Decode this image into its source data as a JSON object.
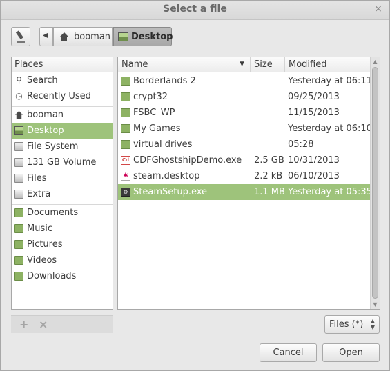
{
  "window": {
    "title": "Select a file",
    "close_glyph": "×"
  },
  "toolbar": {
    "edit_icon": "pencil-icon",
    "back_glyph": "◀",
    "crumbs": [
      {
        "label": "booman",
        "icon": "home-icon"
      },
      {
        "label": "Desktop",
        "icon": "desktop-icon",
        "active": true
      }
    ]
  },
  "places": {
    "header": "Places",
    "items": [
      {
        "label": "Search",
        "icon": "search-icon"
      },
      {
        "label": "Recently Used",
        "icon": "clock-icon"
      },
      {
        "label": "booman",
        "icon": "home-icon"
      },
      {
        "label": "Desktop",
        "icon": "desktop-icon",
        "selected": true
      },
      {
        "label": "File System",
        "icon": "drive-icon"
      },
      {
        "label": "131 GB Volume",
        "icon": "drive-icon"
      },
      {
        "label": "Files",
        "icon": "drive-icon"
      },
      {
        "label": "Extra",
        "icon": "drive-icon"
      },
      {
        "label": "Documents",
        "icon": "folder-documents-icon"
      },
      {
        "label": "Music",
        "icon": "folder-music-icon"
      },
      {
        "label": "Pictures",
        "icon": "folder-pictures-icon"
      },
      {
        "label": "Videos",
        "icon": "folder-videos-icon"
      },
      {
        "label": "Downloads",
        "icon": "folder-downloads-icon"
      }
    ],
    "add_glyph": "+",
    "remove_glyph": "×"
  },
  "files": {
    "columns": {
      "name": "Name",
      "size": "Size",
      "modified": "Modified"
    },
    "sort_glyph": "▼",
    "rows": [
      {
        "name": "Borderlands 2",
        "size": "",
        "modified": "Yesterday at 06:11",
        "icon": "folder-icon"
      },
      {
        "name": "crypt32",
        "size": "",
        "modified": "09/25/2013",
        "icon": "folder-icon"
      },
      {
        "name": "FSBC_WP",
        "size": "",
        "modified": "11/15/2013",
        "icon": "folder-icon"
      },
      {
        "name": "My Games",
        "size": "",
        "modified": "Yesterday at 06:10",
        "icon": "folder-icon"
      },
      {
        "name": "virtual drives",
        "size": "",
        "modified": "05:28",
        "icon": "folder-icon"
      },
      {
        "name": "CDFGhostshipDemo.exe",
        "size": "2.5 GB",
        "modified": "10/31/2013",
        "icon": "exe-icon"
      },
      {
        "name": "steam.desktop",
        "size": "2.2 kB",
        "modified": "06/10/2013",
        "icon": "desktop-file-icon"
      },
      {
        "name": "SteamSetup.exe",
        "size": "1.1 MB",
        "modified": "Yesterday at 05:35",
        "icon": "steam-icon",
        "selected": true
      }
    ]
  },
  "filter": {
    "value": "Files (*)"
  },
  "buttons": {
    "cancel": "Cancel",
    "open": "Open"
  },
  "colors": {
    "selection": "#9ec37b",
    "background": "#e8e8e8"
  }
}
